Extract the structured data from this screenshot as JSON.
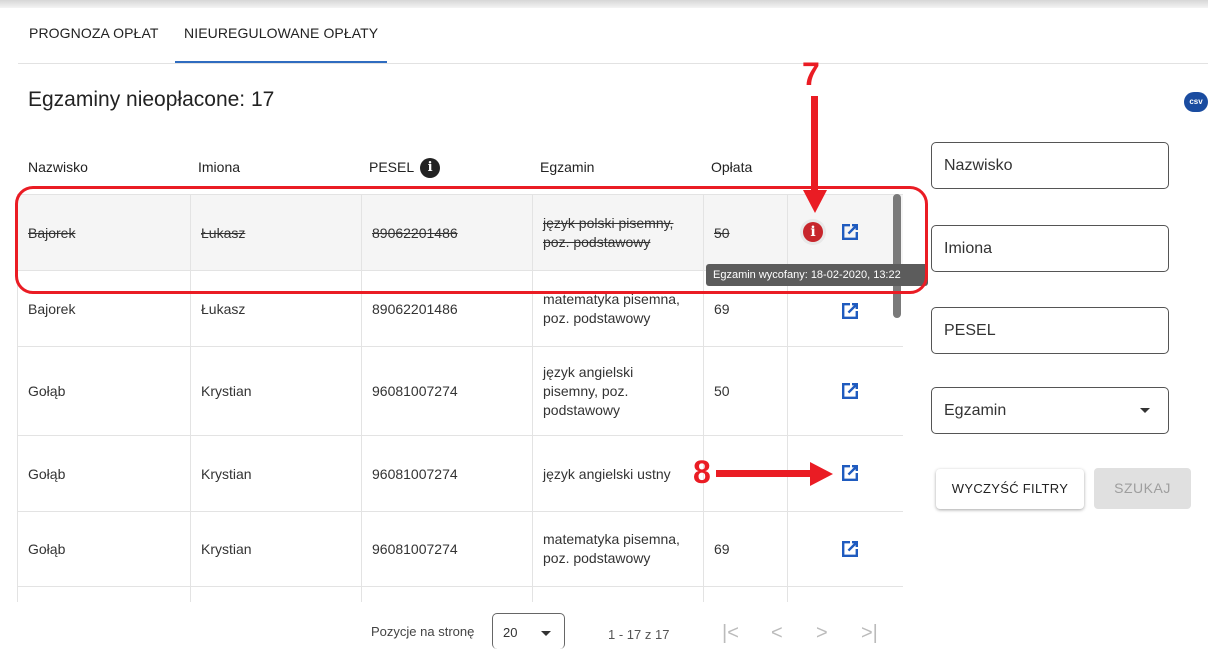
{
  "tabs": [
    {
      "label": "PROGNOZA OPŁAT"
    },
    {
      "label": "NIEUREGULOWANE OPŁATY"
    }
  ],
  "page_title": "Egzaminy nieopłacone: 17",
  "csv_label": "csv",
  "table": {
    "headers": [
      "Nazwisko",
      "Imiona",
      "PESEL",
      "Egzamin",
      "Opłata"
    ],
    "pesel_info_glyph": "i",
    "rows": [
      {
        "nazwisko": "Bajorek",
        "imiona": "Łukasz",
        "pesel": "89062201486",
        "egzamin": "język polski pisemny, poz. podstawowy",
        "oplata": "50",
        "cancelled": true
      },
      {
        "nazwisko": "Bajorek",
        "imiona": "Łukasz",
        "pesel": "89062201486",
        "egzamin": "matematyka pisemna, poz. podstawowy",
        "oplata": "69",
        "cancelled": false
      },
      {
        "nazwisko": "Gołąb",
        "imiona": "Krystian",
        "pesel": "96081007274",
        "egzamin": "język angielski pisemny, poz. podstawowy",
        "oplata": "50",
        "cancelled": false
      },
      {
        "nazwisko": "Gołąb",
        "imiona": "Krystian",
        "pesel": "96081007274",
        "egzamin": "język angielski ustny",
        "oplata": "",
        "cancelled": false
      },
      {
        "nazwisko": "Gołąb",
        "imiona": "Krystian",
        "pesel": "96081007274",
        "egzamin": "matematyka pisemna, poz. podstawowy",
        "oplata": "69",
        "cancelled": false
      }
    ],
    "info_glyph": "i"
  },
  "tooltip": "Egzamin wycofany: 18-02-2020, 13:22",
  "callouts": {
    "seven": "7",
    "eight": "8"
  },
  "filters": {
    "nazwisko": "Nazwisko",
    "imiona": "Imiona",
    "pesel": "PESEL",
    "egzamin": "Egzamin"
  },
  "buttons": {
    "clear": "WYCZYŚĆ FILTRY",
    "search": "SZUKAJ"
  },
  "pager": {
    "label": "Pozycje na stronę",
    "page_size": "20",
    "range": "1 - 17 z 17",
    "first": "|<",
    "prev": "<",
    "next": ">",
    "last": ">|"
  },
  "colors": {
    "accent": "#2f6cc0",
    "callout": "#ea1c24",
    "info_red": "#c7252b",
    "open_icon": "#1f5bbf"
  }
}
